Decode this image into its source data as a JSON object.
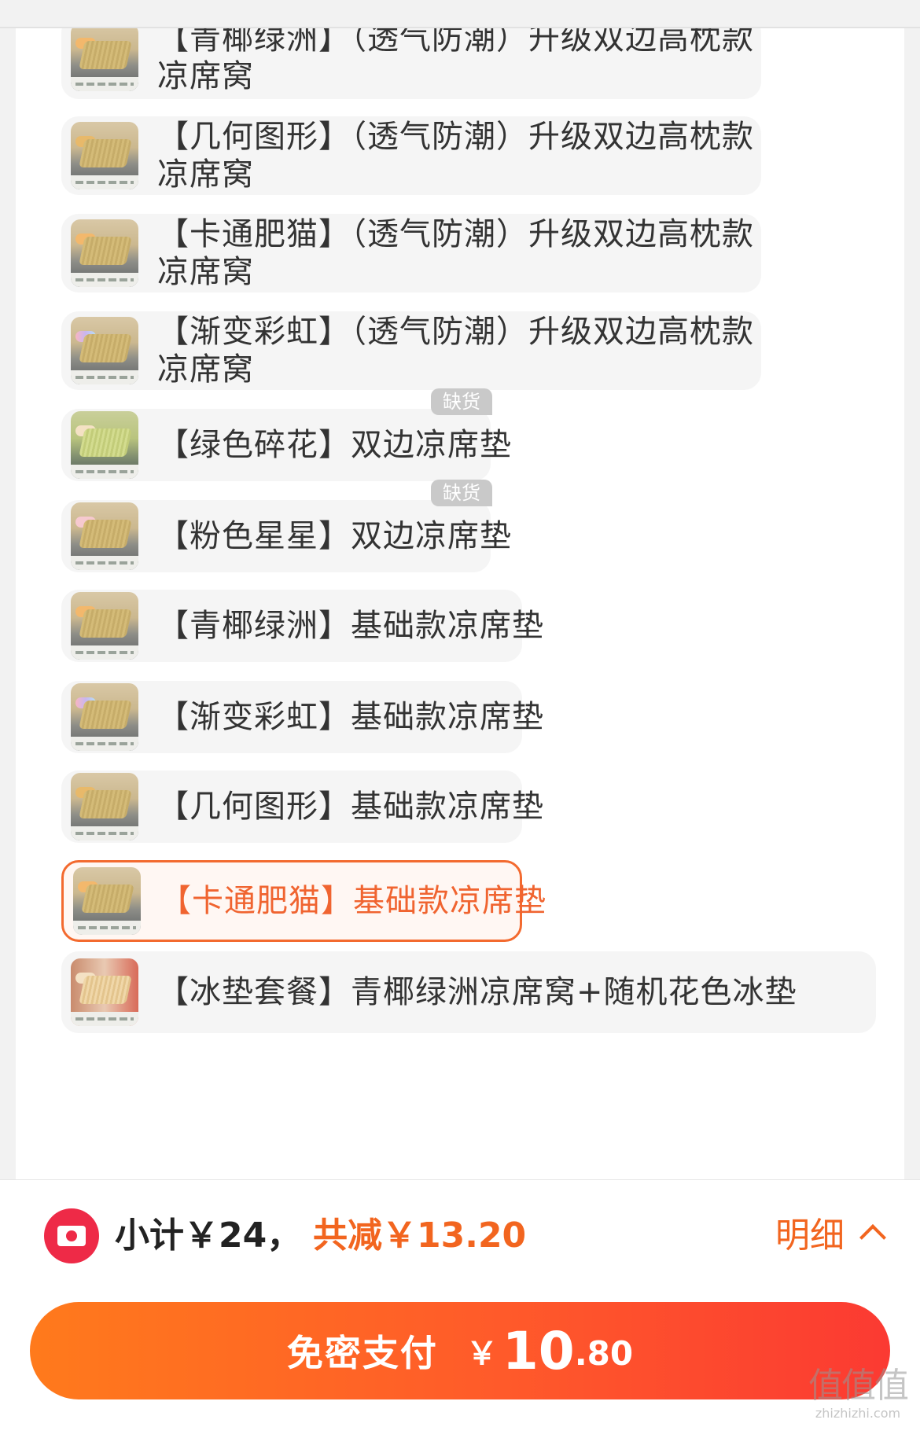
{
  "options": [
    {
      "label": "【青椰绿洲】（透气防潮）升级双边高枕款凉席窝",
      "thumb": "cat-mat-thumbnail"
    },
    {
      "label": "【几何图形】（透气防潮）升级双边高枕款凉席窝",
      "thumb": "cat-mat-thumbnail"
    },
    {
      "label": "【卡通肥猫】（透气防潮）升级双边高枕款凉席窝",
      "thumb": "cat-mat-thumbnail"
    },
    {
      "label": "【渐变彩虹】（透气防潮）升级双边高枕款凉席窝",
      "thumb": "cat-mat-thumbnail"
    },
    {
      "label": "【绿色碎花】双边凉席垫",
      "badge": "缺货",
      "thumb": "green-mat-thumbnail"
    },
    {
      "label": "【粉色星星】双边凉席垫",
      "badge": "缺货",
      "thumb": "pink-mat-thumbnail"
    },
    {
      "label": "【青椰绿洲】基础款凉席垫",
      "thumb": "cat-mat-thumbnail"
    },
    {
      "label": "【渐变彩虹】基础款凉席垫",
      "thumb": "rainbow-mat-thumbnail"
    },
    {
      "label": "【几何图形】基础款凉席垫",
      "thumb": "cat-mat-thumbnail"
    },
    {
      "label": "【卡通肥猫】基础款凉席垫",
      "selected": true,
      "thumb": "cat-mat-thumbnail"
    },
    {
      "label": "【冰垫套餐】青椰绿洲凉席窝+随机花色冰垫",
      "thumb": "combo-thumbnail"
    }
  ],
  "footer": {
    "coupon_icon": "coupon-icon",
    "subtotal": "小计￥24，",
    "discount": "共减￥13.20",
    "detail_label": "明细",
    "detail_icon": "chevron-up-icon"
  },
  "pay_button": {
    "label": "免密支付",
    "currency": "￥",
    "amount_int": "10",
    "amount_dec": ".80"
  },
  "watermark": {
    "brand": "值值值",
    "domain": "zhizhizhi.com"
  },
  "colors": {
    "accent": "#f2651f",
    "selected_border": "#f36a2f",
    "pay_gradient_start": "#ff7a1c",
    "pay_gradient_end": "#fb3a32",
    "out_of_stock_badge": "#c9c9c9"
  }
}
